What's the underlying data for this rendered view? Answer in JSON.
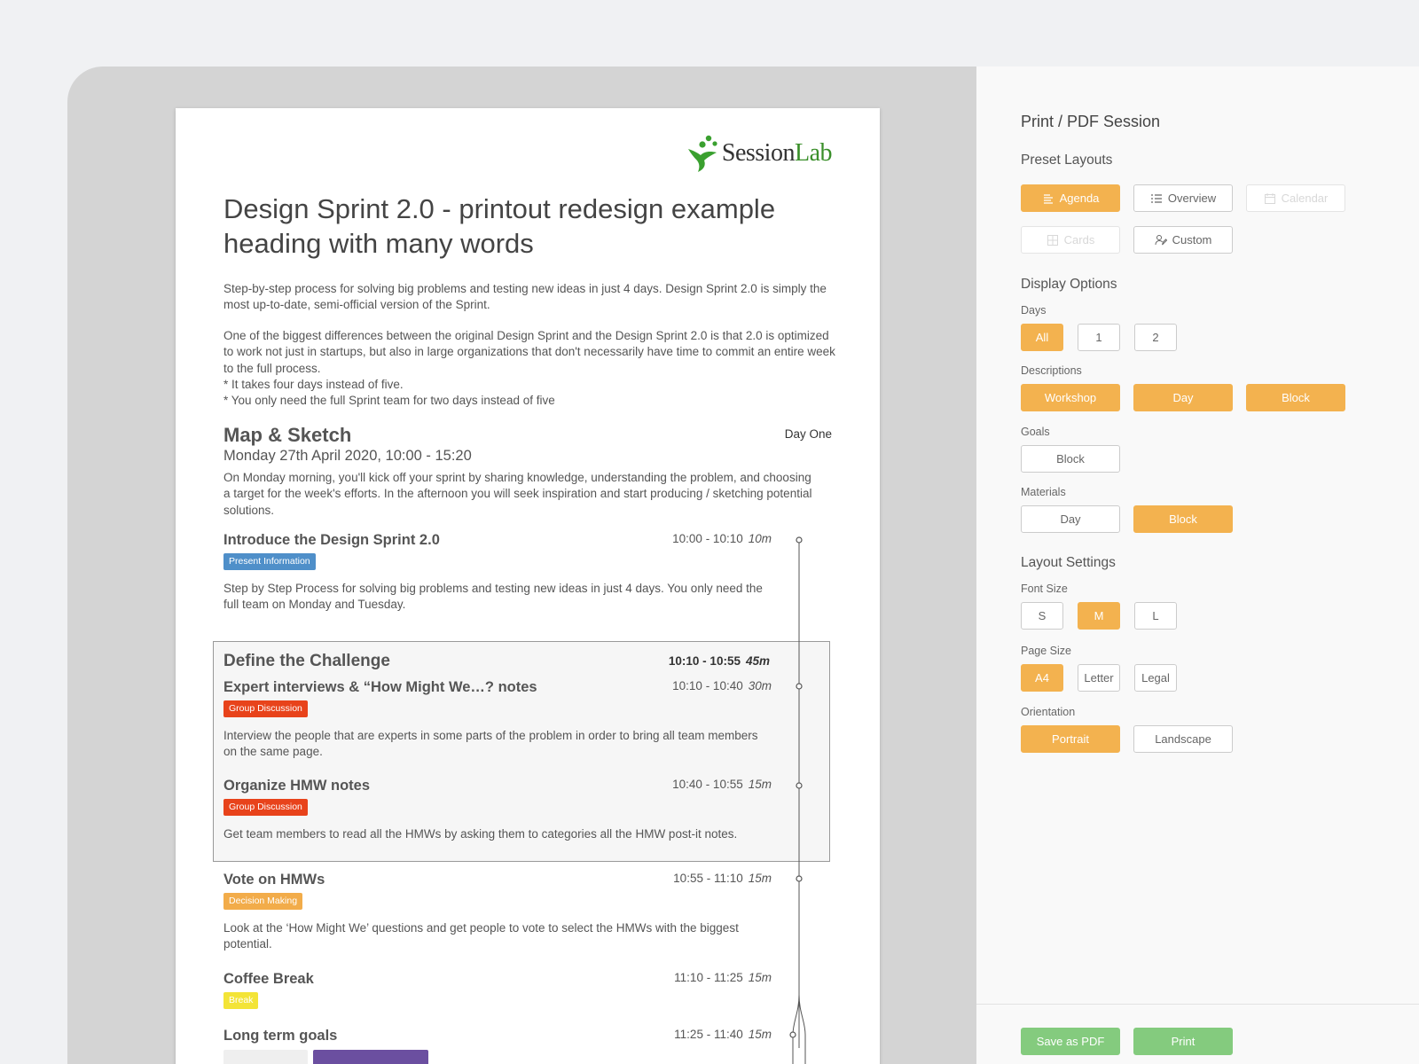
{
  "document": {
    "brand": {
      "logo_text_main": "Session",
      "logo_text_accent": "Lab"
    },
    "title": "Design Sprint 2.0 - printout redesign example heading with many words",
    "intro_1": "Step-by-step process for solving big problems and testing new ideas in just 4 days. Design Sprint 2.0 is simply the most up-to-date, semi-official version of the Sprint.",
    "intro_2": "One of the biggest differences between the original Design Sprint and the Design Sprint 2.0 is that 2.0 is optimized to work not just in startups, but also in large organizations that don't necessarily have time to commit an entire week to the full process.",
    "intro_3": "* It takes four days instead of five.",
    "intro_4": "* You only need the full Sprint team for two days instead of five",
    "day": {
      "title": "Map & Sketch",
      "label": "Day One",
      "date": "Monday 27th April 2020, 10:00 - 15:20",
      "description": "On Monday morning, you'll kick off your sprint by sharing knowledge, understanding the problem, and choosing a target for the week's efforts. In the afternoon you will seek inspiration and start producing / sketching potential solutions."
    },
    "block": {
      "title": "Define the Challenge",
      "time": "10:10 - 10:55",
      "duration": "45m"
    },
    "items": [
      {
        "title": "Introduce the Design Sprint 2.0",
        "time": "10:00 - 10:10",
        "duration": "10m",
        "tag": "Present Information",
        "description": "Step by Step Process for solving big problems and testing new ideas in just 4 days. You only need the full team on Monday and Tuesday."
      },
      {
        "title": "Expert interviews & “How Might We…? notes",
        "time": "10:10 - 10:40",
        "duration": "30m",
        "tag": "Group Discussion",
        "description": "Interview the people that are experts in some parts of the problem in order to bring all team members on the same page."
      },
      {
        "title": "Organize HMW notes",
        "time": "10:40 - 10:55",
        "duration": "15m",
        "tag": "Group Discussion",
        "description": "Get team members to read all the HMWs by asking them to categories all the HMW post-it notes."
      },
      {
        "title": "Vote on HMWs",
        "time": "10:55 - 11:10",
        "duration": "15m",
        "tag": "Decision Making",
        "description": "Look at the ‘How Might We’ questions and get people to vote to select the HMWs with the biggest potential."
      },
      {
        "title": "Coffee Break",
        "time": "11:10 - 11:25",
        "duration": "15m",
        "tag": "Break",
        "description": ""
      },
      {
        "title": "Long term goals",
        "time": "11:25 - 11:40",
        "duration": "15m",
        "tag": "",
        "description": ""
      }
    ],
    "tag_colors": {
      "Present Information": "#4f8fc9",
      "Group Discussion": "#e8431b",
      "Decision Making": "#f2ac4a",
      "Break": "#f3e437"
    }
  },
  "panel": {
    "title": "Print / PDF Session",
    "preset_layouts": {
      "heading": "Preset Layouts",
      "options": [
        {
          "label": "Agenda",
          "icon": "agenda-icon",
          "state": "selected"
        },
        {
          "label": "Overview",
          "icon": "list-icon",
          "state": "default"
        },
        {
          "label": "Calendar",
          "icon": "calendar-icon",
          "state": "disabled"
        },
        {
          "label": "Cards",
          "icon": "grid-icon",
          "state": "disabled"
        },
        {
          "label": "Custom",
          "icon": "user-edit-icon",
          "state": "default"
        }
      ]
    },
    "display_options": {
      "heading": "Display Options",
      "days": {
        "label": "Days",
        "options": [
          "All",
          "1",
          "2"
        ],
        "selected": "All"
      },
      "descriptions": {
        "label": "Descriptions",
        "options": [
          "Workshop",
          "Day",
          "Block"
        ],
        "selected": [
          "Workshop",
          "Day",
          "Block"
        ]
      },
      "goals": {
        "label": "Goals",
        "options": [
          "Block"
        ],
        "selected": []
      },
      "materials": {
        "label": "Materials",
        "options": [
          "Day",
          "Block"
        ],
        "selected": [
          "Block"
        ]
      }
    },
    "layout_settings": {
      "heading": "Layout Settings",
      "font_size": {
        "label": "Font Size",
        "options": [
          "S",
          "M",
          "L"
        ],
        "selected": "M"
      },
      "page_size": {
        "label": "Page Size",
        "options": [
          "A4",
          "Letter",
          "Legal"
        ],
        "selected": "A4"
      },
      "orientation": {
        "label": "Orientation",
        "options": [
          "Portrait",
          "Landscape"
        ],
        "selected": "Portrait"
      }
    },
    "actions": {
      "save_pdf": "Save as PDF",
      "print": "Print"
    },
    "colors": {
      "accent": "#f3b24f",
      "action": "#84cb7e"
    }
  }
}
